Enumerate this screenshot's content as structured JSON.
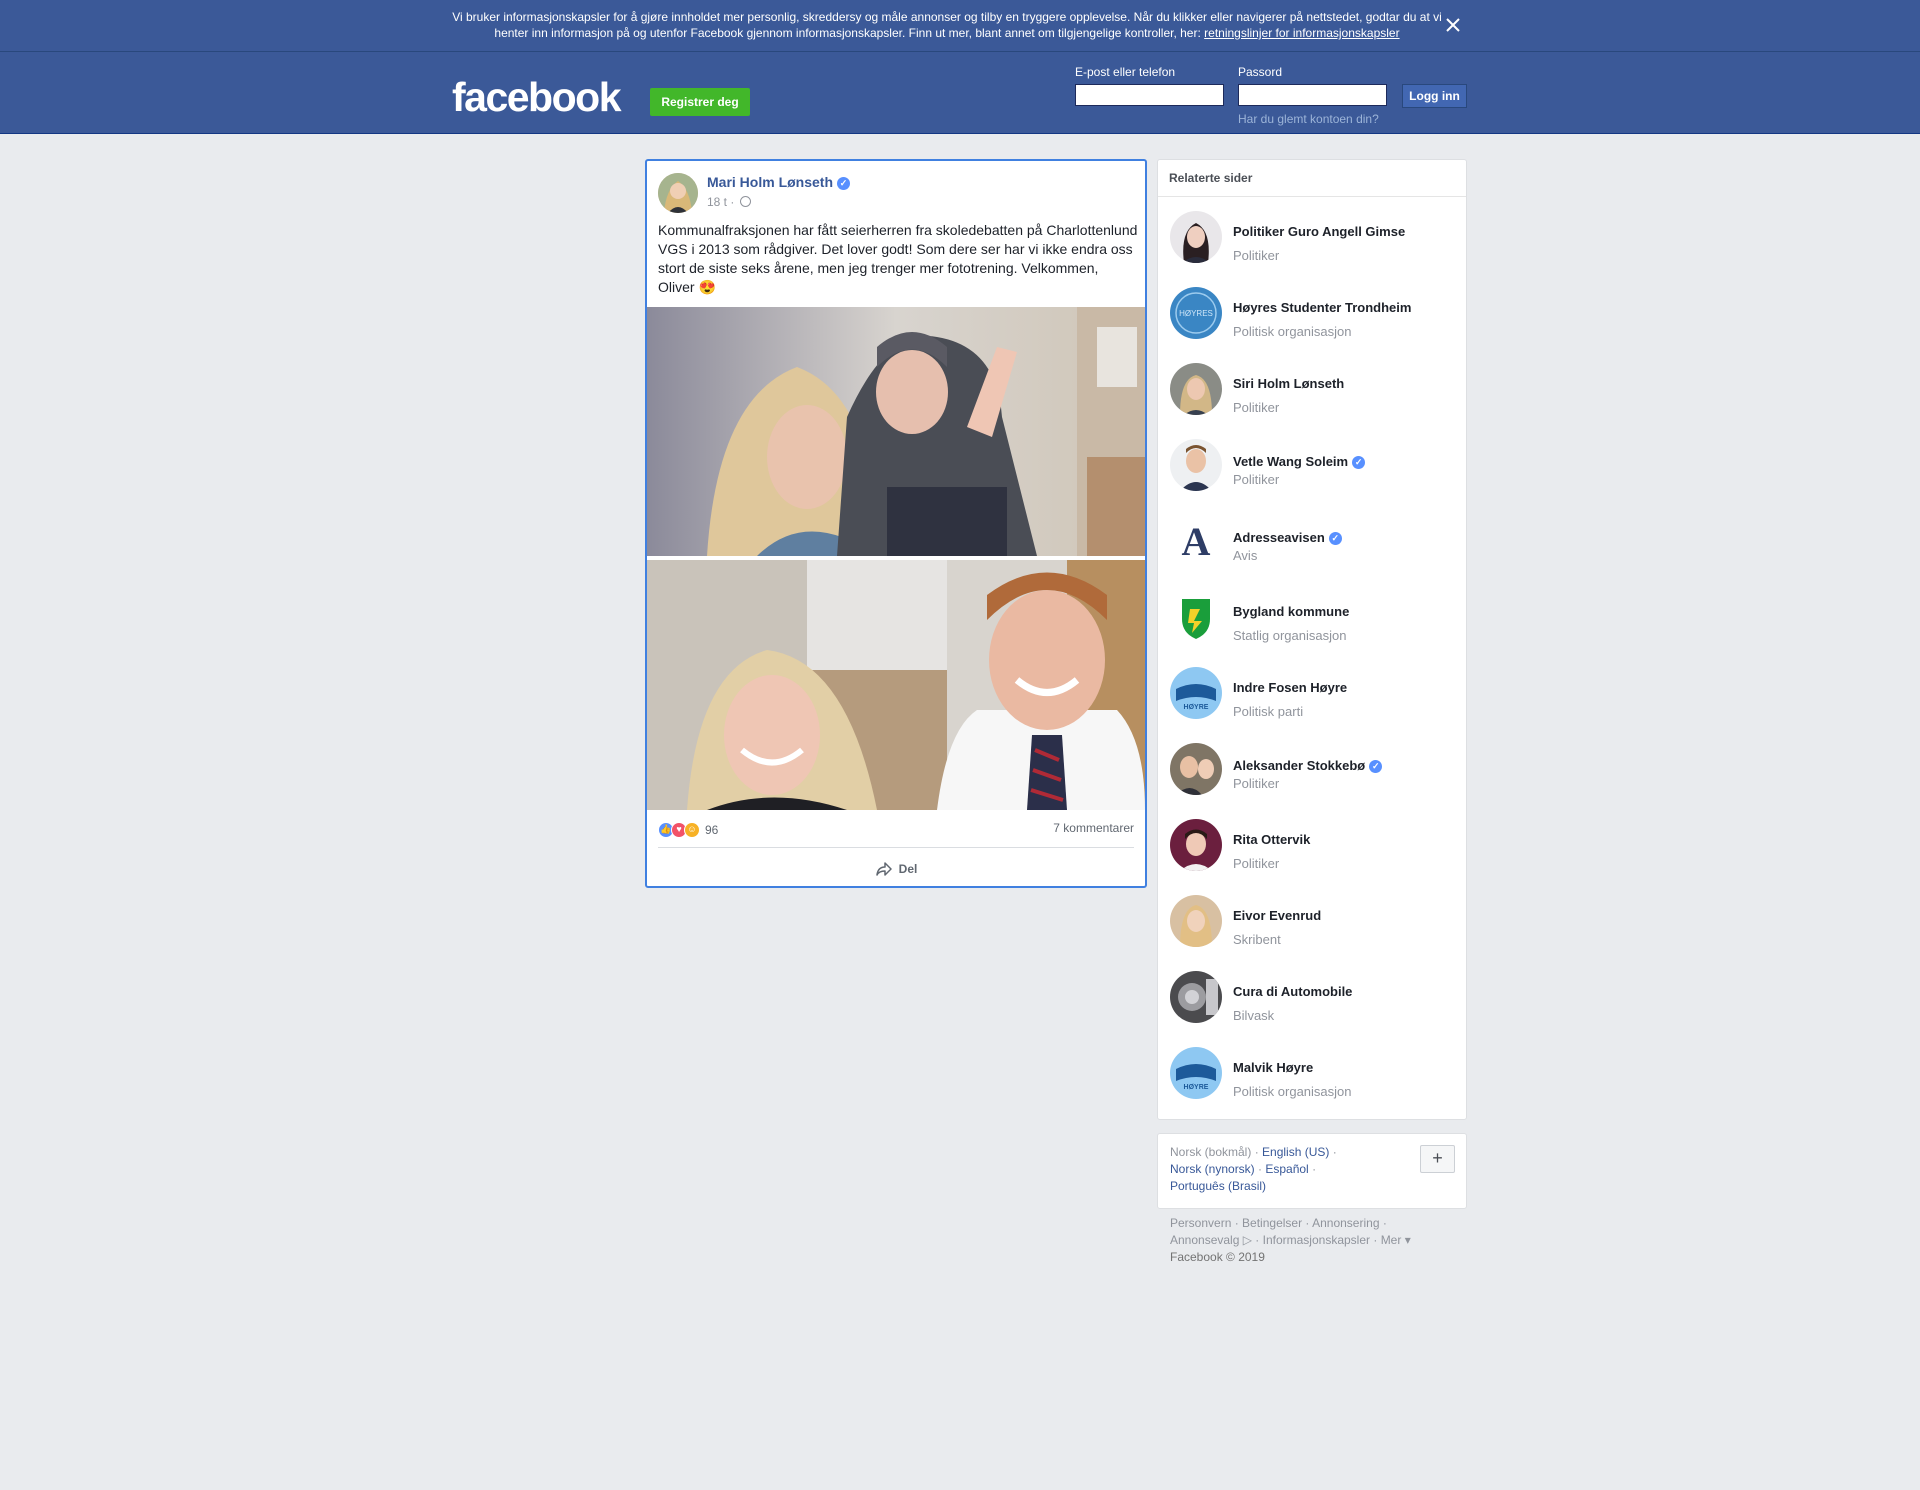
{
  "cookie_banner": {
    "text": "Vi bruker informasjonskapsler for å gjøre innholdet mer personlig, skreddersy og måle annonser og tilby en tryggere opplevelse. Når du klikker eller navigerer på nettstedet, godtar du at vi henter inn informasjon på og utenfor Facebook gjennom informasjonskapsler. Finn ut mer, blant annet om tilgjengelige kontroller, her: ",
    "link": "retningslinjer for informasjonskapsler",
    "close_icon": "close-icon"
  },
  "header": {
    "logo": "facebook",
    "register_label": "Registrer deg",
    "email_label": "E-post eller telefon",
    "password_label": "Passord",
    "login_label": "Logg inn",
    "forgot_label": "Har du glemt kontoen din?",
    "email_value": "",
    "password_value": ""
  },
  "post": {
    "author": "Mari Holm Lønseth",
    "verified_icon": "verified-badge-icon",
    "time": "18 t",
    "privacy_icon": "globe-icon",
    "text": "Kommunalfraksjonen har fått seierherren fra skoledebatten på Charlottenlund VGS i 2013 som rådgiver. Det lover godt! Som dere ser har vi ikke endra oss stort de siste seks årene, men jeg trenger mer fototrening. Velkommen, Oliver 😍",
    "reaction_icons": [
      "like-icon",
      "love-icon",
      "haha-icon"
    ],
    "reaction_count": "96",
    "comments": "7 kommentarer",
    "share_label": "Del"
  },
  "related": {
    "title": "Relaterte sider",
    "pages": [
      {
        "name": "Politiker Guro Angell Gimse",
        "category": "Politiker",
        "verified": false
      },
      {
        "name": "Høyres Studenter Trondheim",
        "category": "Politisk organisasjon",
        "verified": false
      },
      {
        "name": "Siri Holm Lønseth",
        "category": "Politiker",
        "verified": false
      },
      {
        "name": "Vetle Wang Soleim",
        "category": "Politiker",
        "verified": true
      },
      {
        "name": "Adresseavisen",
        "category": "Avis",
        "verified": true
      },
      {
        "name": "Bygland kommune",
        "category": "Statlig organisasjon",
        "verified": false
      },
      {
        "name": "Indre Fosen Høyre",
        "category": "Politisk parti",
        "verified": false
      },
      {
        "name": "Aleksander Stokkebø",
        "category": "Politiker",
        "verified": true
      },
      {
        "name": "Rita Ottervik",
        "category": "Politiker",
        "verified": false
      },
      {
        "name": "Eivor Evenrud",
        "category": "Skribent",
        "verified": false
      },
      {
        "name": "Cura di Automobile",
        "category": "Bilvask",
        "verified": false
      },
      {
        "name": "Malvik Høyre",
        "category": "Politisk organisasjon",
        "verified": false
      }
    ]
  },
  "languages": {
    "current": "Norsk (bokmål)",
    "english": "English (US)",
    "nynorsk": "Norsk (nynorsk)",
    "spanish": "Español",
    "portuguese": "Português (Brasil)",
    "plus": "+"
  },
  "footer": {
    "privacy": "Personvern",
    "terms": "Betingelser",
    "advertising": "Annonsering",
    "ad_choices": "Annonsevalg",
    "cookies": "Informasjonskapsler",
    "more": "Mer",
    "copyright": "Facebook © 2019"
  },
  "colors": {
    "brand_blue": "#3b5998",
    "register_green": "#42b72a",
    "link_blue": "#385898",
    "verified_blue": "#5890ff",
    "page_bg": "#e9ebee"
  }
}
